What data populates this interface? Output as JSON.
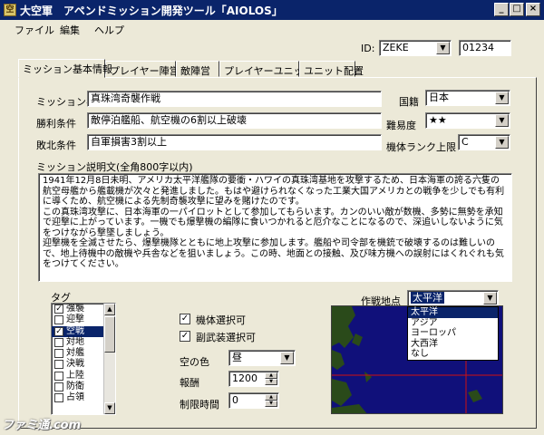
{
  "window": {
    "title": "大空軍　アペンドミッション開発ツール「AIOLOS」",
    "controls": [
      "_",
      "□",
      "×"
    ]
  },
  "menu": [
    "ファイル",
    "編集",
    "ヘルプ"
  ],
  "id_row": {
    "label": "ID:",
    "user": "ZEKE",
    "number": "01234"
  },
  "tabs": [
    "ミッション基本情報",
    "プレイヤー陣営",
    "敵陣営",
    "プレイヤーユニット",
    "ユニット配置"
  ],
  "form": {
    "mission_name_label": "ミッション名",
    "mission_name": "真珠湾奇襲作戦",
    "victory_label": "勝利条件",
    "victory": "敵停泊艦船、航空機の6割以上破壊",
    "defeat_label": "敗北条件",
    "defeat": "自軍損害3割以上",
    "nation_label": "国籍",
    "nation": "日本",
    "difficulty_label": "難易度",
    "difficulty": "★★",
    "rank_label": "機体ランク上限",
    "rank": "C"
  },
  "description": {
    "label": "ミッション説明文(全角800字以内)",
    "text": "1941年12月8日未明、アメリカ太平洋艦隊の要衝・ハワイの真珠湾基地を攻撃するため、日本海軍の誇る六隻の航空母艦から艦載機が次々と発進しました。もはや避けられなくなった工業大国アメリカとの戦争を少しでも有利に導くため、航空機による先制奇襲攻撃に望みを賭けたのです。\nこの真珠湾攻撃に、日本海軍の一パイロットとして参加してもらいます。カンのいい敵が数機、多勢に無勢を承知で迎撃に上がっています。一機でも爆撃機の編隊に食いつかれると厄介なことになるので、深追いしないように気をつけながら撃墜しましょう。\n迎撃機を全滅させたら、爆撃機隊とともに地上攻撃に参加します。艦船や司令部を機銃で破壊するのは難しいので、地上待機中の敵機や兵舎などを狙いましょう。この時、地面との接触、及び味方機への誤射にはくれぐれも気をつけてください。"
  },
  "tags": {
    "label": "タグ",
    "items": [
      {
        "label": "強襲",
        "checked": true
      },
      {
        "label": "迎撃",
        "checked": false
      },
      {
        "label": "空戦",
        "checked": true
      },
      {
        "label": "対地",
        "checked": false
      },
      {
        "label": "対艦",
        "checked": false
      },
      {
        "label": "決戦",
        "checked": false
      },
      {
        "label": "上陸",
        "checked": false
      },
      {
        "label": "防衛",
        "checked": false
      },
      {
        "label": "占領",
        "checked": false
      }
    ],
    "selected_index": 2
  },
  "options": {
    "aircraft_select": "機体選択可",
    "subweapon_select": "副武装選択可",
    "sky_label": "空の色",
    "sky": "昼",
    "reward_label": "報酬",
    "reward": "1200",
    "time_label": "制限時間",
    "time": "0"
  },
  "location": {
    "label": "作戦地点",
    "value": "太平洋",
    "options": [
      "太平洋",
      "アジア",
      "ヨーロッパ",
      "大西洋",
      "なし"
    ],
    "selected_index": 0
  },
  "watermark": "ファミ通.com",
  "colors": {
    "titlebar": "#0a246a",
    "window_bg": "#ece9d8",
    "selection": "#0a246a",
    "map_sea": "#10107a"
  }
}
